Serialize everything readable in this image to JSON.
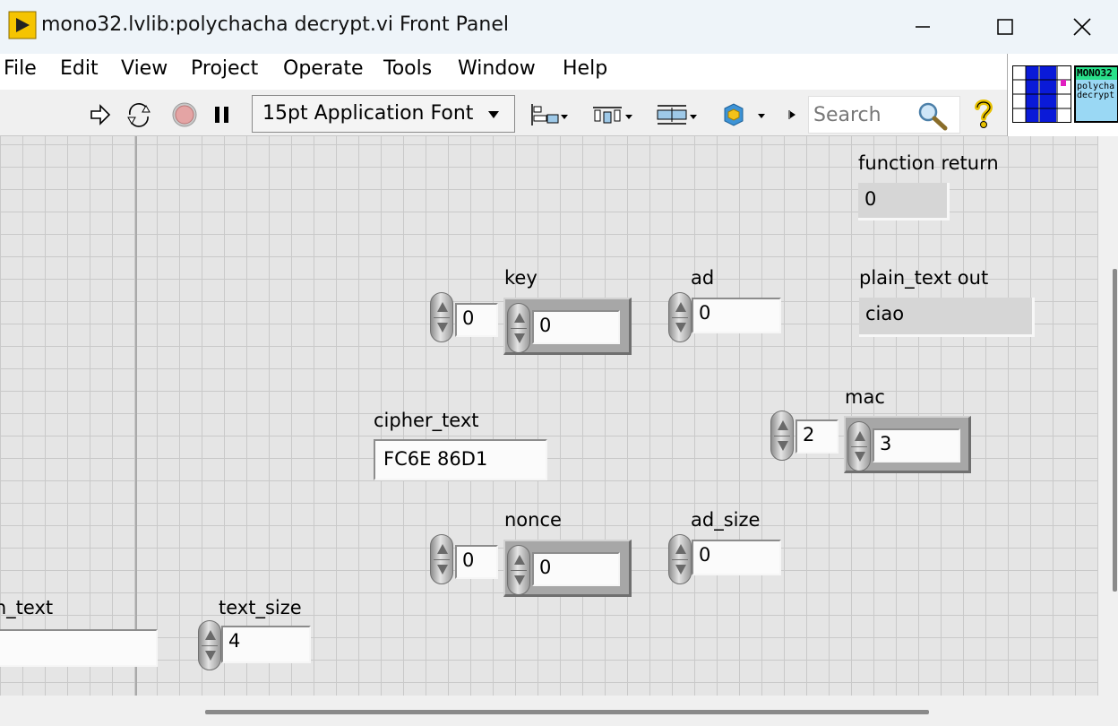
{
  "window": {
    "title": "mono32.lvlib:polychacha decrypt.vi Front Panel"
  },
  "menu": [
    "File",
    "Edit",
    "View",
    "Project",
    "Operate",
    "Tools",
    "Window",
    "Help"
  ],
  "toolbar": {
    "font": "15pt Application Font",
    "search_placeholder": "Search"
  },
  "vi_icon": {
    "line1": "MONO32",
    "line2": "polycha",
    "line3": "decrypt"
  },
  "panel": {
    "function_return": {
      "label": "function return",
      "value": "0"
    },
    "key": {
      "label": "key",
      "index": "0",
      "value": "0"
    },
    "ad": {
      "label": "ad",
      "value": "0"
    },
    "plain_text_out": {
      "label": "plain_text out",
      "value": "ciao"
    },
    "mac": {
      "label": "mac",
      "index": "2",
      "value": "3"
    },
    "cipher_text": {
      "label": "cipher_text",
      "value": "FC6E 86D1"
    },
    "nonce": {
      "label": "nonce",
      "index": "0",
      "value": "0"
    },
    "ad_size": {
      "label": "ad_size",
      "value": "0"
    },
    "plain_text": {
      "label": "plain_text",
      "value": ""
    },
    "text_size": {
      "label": "text_size",
      "value": "4"
    }
  },
  "colors": {
    "labview_icon_yellow": "#f5c400",
    "panel_bg": "#e5e5e5",
    "grid": "#c9c9c9"
  }
}
